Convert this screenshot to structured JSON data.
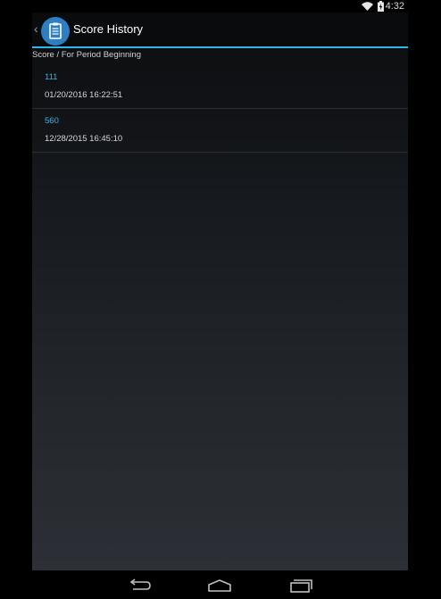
{
  "status_bar": {
    "time": "4:32"
  },
  "action_bar": {
    "title": "Score History",
    "app_icon": "clipboard-icon"
  },
  "section": {
    "header": "Score / For Period Beginning"
  },
  "history": [
    {
      "score": "111",
      "date": "01/20/2016 16:22:51"
    },
    {
      "score": "560",
      "date": "12/28/2015 16:45:10"
    }
  ],
  "colors": {
    "accent": "#33b5e5",
    "icon_bg": "#2e7fc1"
  },
  "nav": {
    "back": "back-icon",
    "home": "home-icon",
    "recents": "recent-apps-icon"
  }
}
